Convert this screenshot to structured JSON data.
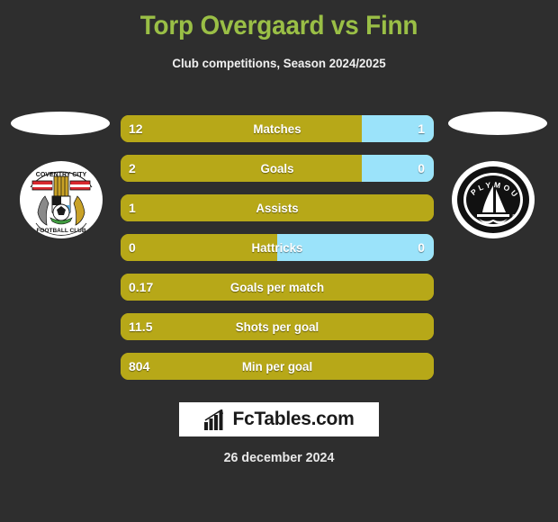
{
  "header": {
    "title": "Torp Overgaard vs Finn",
    "subtitle": "Club competitions, Season 2024/2025",
    "title_color": "#9abf46"
  },
  "colors": {
    "background": "#2e2e2e",
    "home_bar": "#b7a818",
    "away_bar": "#9be3fa",
    "text": "#ffffff"
  },
  "teams": {
    "home": {
      "crest_name": "coventry-city-crest",
      "crest_text_top": "COVENTRY CITY",
      "crest_text_bottom": "FOOTBALL CLUB"
    },
    "away": {
      "crest_name": "plymouth-crest",
      "crest_text": "PLYMOUTH"
    }
  },
  "stats": [
    {
      "label": "Matches",
      "home": "12",
      "away": "1",
      "home_pct": 77,
      "away_pct": 23,
      "has_away": true
    },
    {
      "label": "Goals",
      "home": "2",
      "away": "0",
      "home_pct": 77,
      "away_pct": 23,
      "has_away": true
    },
    {
      "label": "Assists",
      "home": "1",
      "away": "",
      "home_pct": 100,
      "away_pct": 0,
      "has_away": false
    },
    {
      "label": "Hattricks",
      "home": "0",
      "away": "0",
      "home_pct": 50,
      "away_pct": 50,
      "has_away": true
    },
    {
      "label": "Goals per match",
      "home": "0.17",
      "away": "",
      "home_pct": 100,
      "away_pct": 0,
      "has_away": false
    },
    {
      "label": "Shots per goal",
      "home": "11.5",
      "away": "",
      "home_pct": 100,
      "away_pct": 0,
      "has_away": false
    },
    {
      "label": "Min per goal",
      "home": "804",
      "away": "",
      "home_pct": 100,
      "away_pct": 0,
      "has_away": false
    }
  ],
  "footer": {
    "brand": "FcTables.com",
    "date": "26 december 2024"
  }
}
